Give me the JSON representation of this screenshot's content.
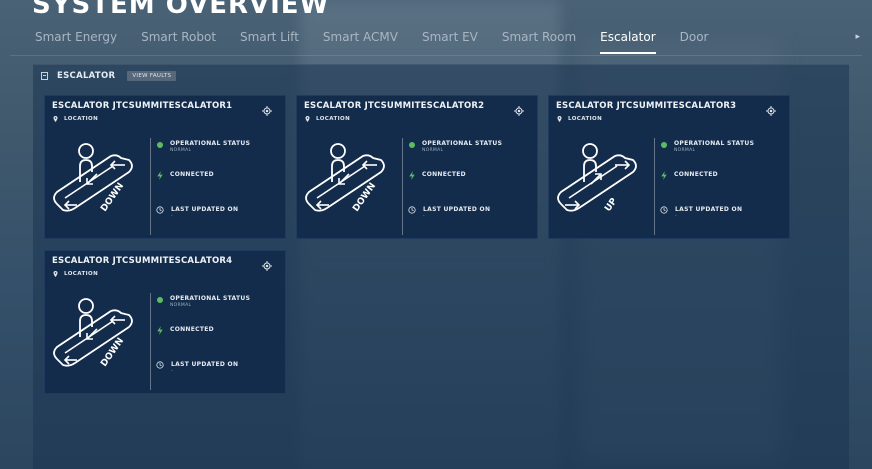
{
  "page": {
    "title": "SYSTEM OVERVIEW"
  },
  "tabs": [
    {
      "label": "Smart Energy",
      "active": false
    },
    {
      "label": "Smart Robot",
      "active": false
    },
    {
      "label": "Smart Lift",
      "active": false
    },
    {
      "label": "Smart ACMV",
      "active": false
    },
    {
      "label": "Smart EV",
      "active": false
    },
    {
      "label": "Smart Room",
      "active": false
    },
    {
      "label": "Escalator",
      "active": true
    },
    {
      "label": "Door",
      "active": false
    }
  ],
  "tabs_scroll_icon": "triangle-right-icon",
  "panel": {
    "title": "ESCALATOR",
    "faults_button": "VIEW FAULTS",
    "icon": "list-icon"
  },
  "card_labels": {
    "location": "LOCATION",
    "operational_status": "OPERATIONAL STATUS",
    "connected": "CONNECTED",
    "last_updated": "LAST UPDATED ON"
  },
  "cards": [
    {
      "title": "ESCALATOR JTCSUMMITESCALATOR1",
      "direction": "DOWN",
      "status": "NORMAL",
      "last_updated": "-"
    },
    {
      "title": "ESCALATOR JTCSUMMITESCALATOR2",
      "direction": "DOWN",
      "status": "NORMAL",
      "last_updated": "-"
    },
    {
      "title": "ESCALATOR JTCSUMMITESCALATOR3",
      "direction": "UP",
      "status": "NORMAL",
      "last_updated": "-"
    },
    {
      "title": "ESCALATOR JTCSUMMITESCALATOR4",
      "direction": "DOWN",
      "status": "NORMAL",
      "last_updated": "-"
    }
  ],
  "colors": {
    "status_ok": "#5dbb63",
    "card_bg": "#142c4b",
    "active_tab": "#ffffff"
  }
}
